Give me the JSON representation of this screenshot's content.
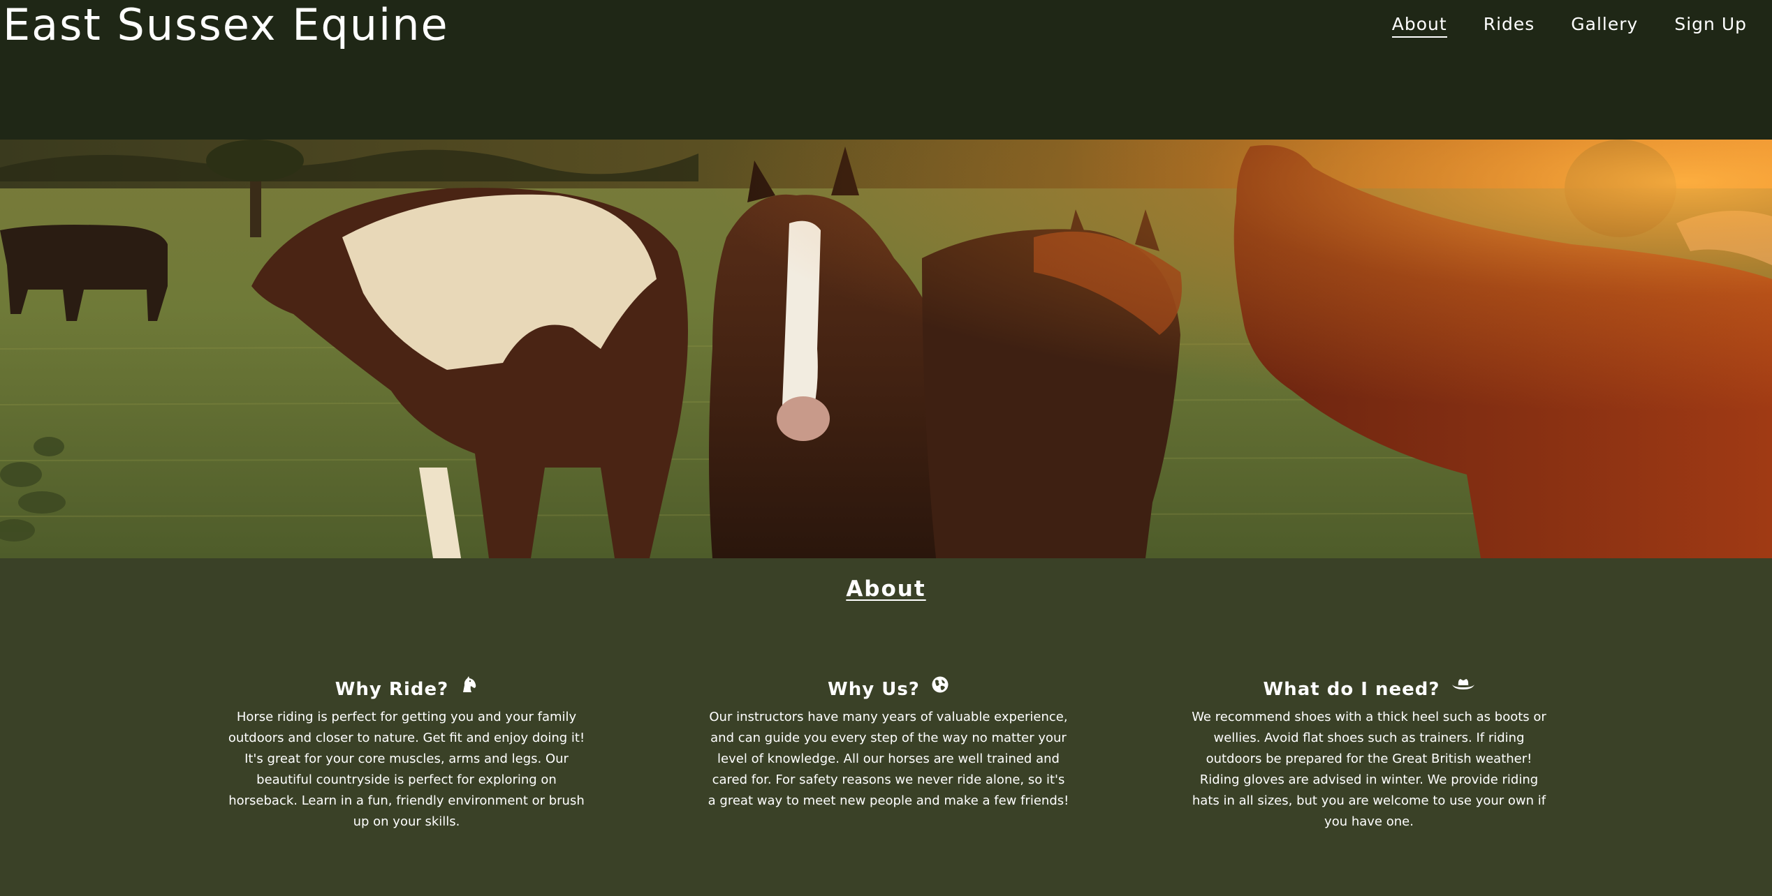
{
  "site": {
    "title": "East Sussex Equine"
  },
  "nav": {
    "items": [
      {
        "label": "About",
        "active": true
      },
      {
        "label": "Rides",
        "active": false
      },
      {
        "label": "Gallery",
        "active": false
      },
      {
        "label": "Sign Up",
        "active": false
      }
    ]
  },
  "hero": {
    "image_icon": "horses-in-field-photo"
  },
  "about": {
    "heading": "About",
    "columns": [
      {
        "title": "Why Ride?",
        "icon": "horse-head-icon",
        "text": "Horse riding is perfect for getting you and your family outdoors and closer to nature. Get fit and enjoy doing it! It's great for your core muscles, arms and legs. Our beautiful countryside is perfect for exploring on horseback. Learn in a fun, friendly environment or brush up on your skills."
      },
      {
        "title": "Why Us?",
        "icon": "globe-icon",
        "text": "Our instructors have many years of valuable experience, and can guide you every step of the way no matter your level of knowledge. All our horses are well trained and cared for. For safety reasons we never ride alone, so it's a great way to meet new people and make a few friends!"
      },
      {
        "title": "What do I need?",
        "icon": "cowboy-hat-icon",
        "text": "We recommend shoes with a thick heel such as boots or wellies. Avoid flat shoes such as trainers. If riding outdoors be prepared for the Great British weather! Riding gloves are advised in winter. We provide riding hats in all sizes, but you are welcome to use your own if you have one."
      }
    ]
  },
  "colors": {
    "header_bg": "#1f2716",
    "page_bg": "#3a4127",
    "text": "#ffffff"
  }
}
